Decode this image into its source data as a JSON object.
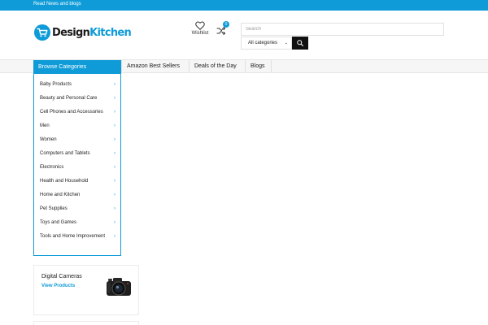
{
  "topbar": {
    "text": "Read News and blogs"
  },
  "logo": {
    "part1": "Design",
    "part2": "Kitchen",
    "icon": "cart-icon"
  },
  "header": {
    "wishlist_label": "Wishlist",
    "compare_count": "0"
  },
  "search": {
    "placeholder": "Search",
    "category_value": "All categories"
  },
  "nav": {
    "browse_label": "Browse Categories",
    "links": [
      "Amazon Best Sellers",
      "Deals of the Day",
      "Blogs"
    ]
  },
  "categories": [
    "Baby Products",
    "Beauty and Personal Care",
    "Cell Phones and Accessories",
    "Men",
    "Women",
    "Computers and Tablets",
    "Electronics",
    "Health and Household",
    "Home and Kitchen",
    "Pet Supplies",
    "Toys and Games",
    "Tools and Home Improvement"
  ],
  "promo": {
    "title": "Digital Cameras",
    "link": "View Products"
  },
  "colors": {
    "accent": "#0e9bd8",
    "dark": "#111111",
    "nav_bg": "#f6f6f6"
  }
}
